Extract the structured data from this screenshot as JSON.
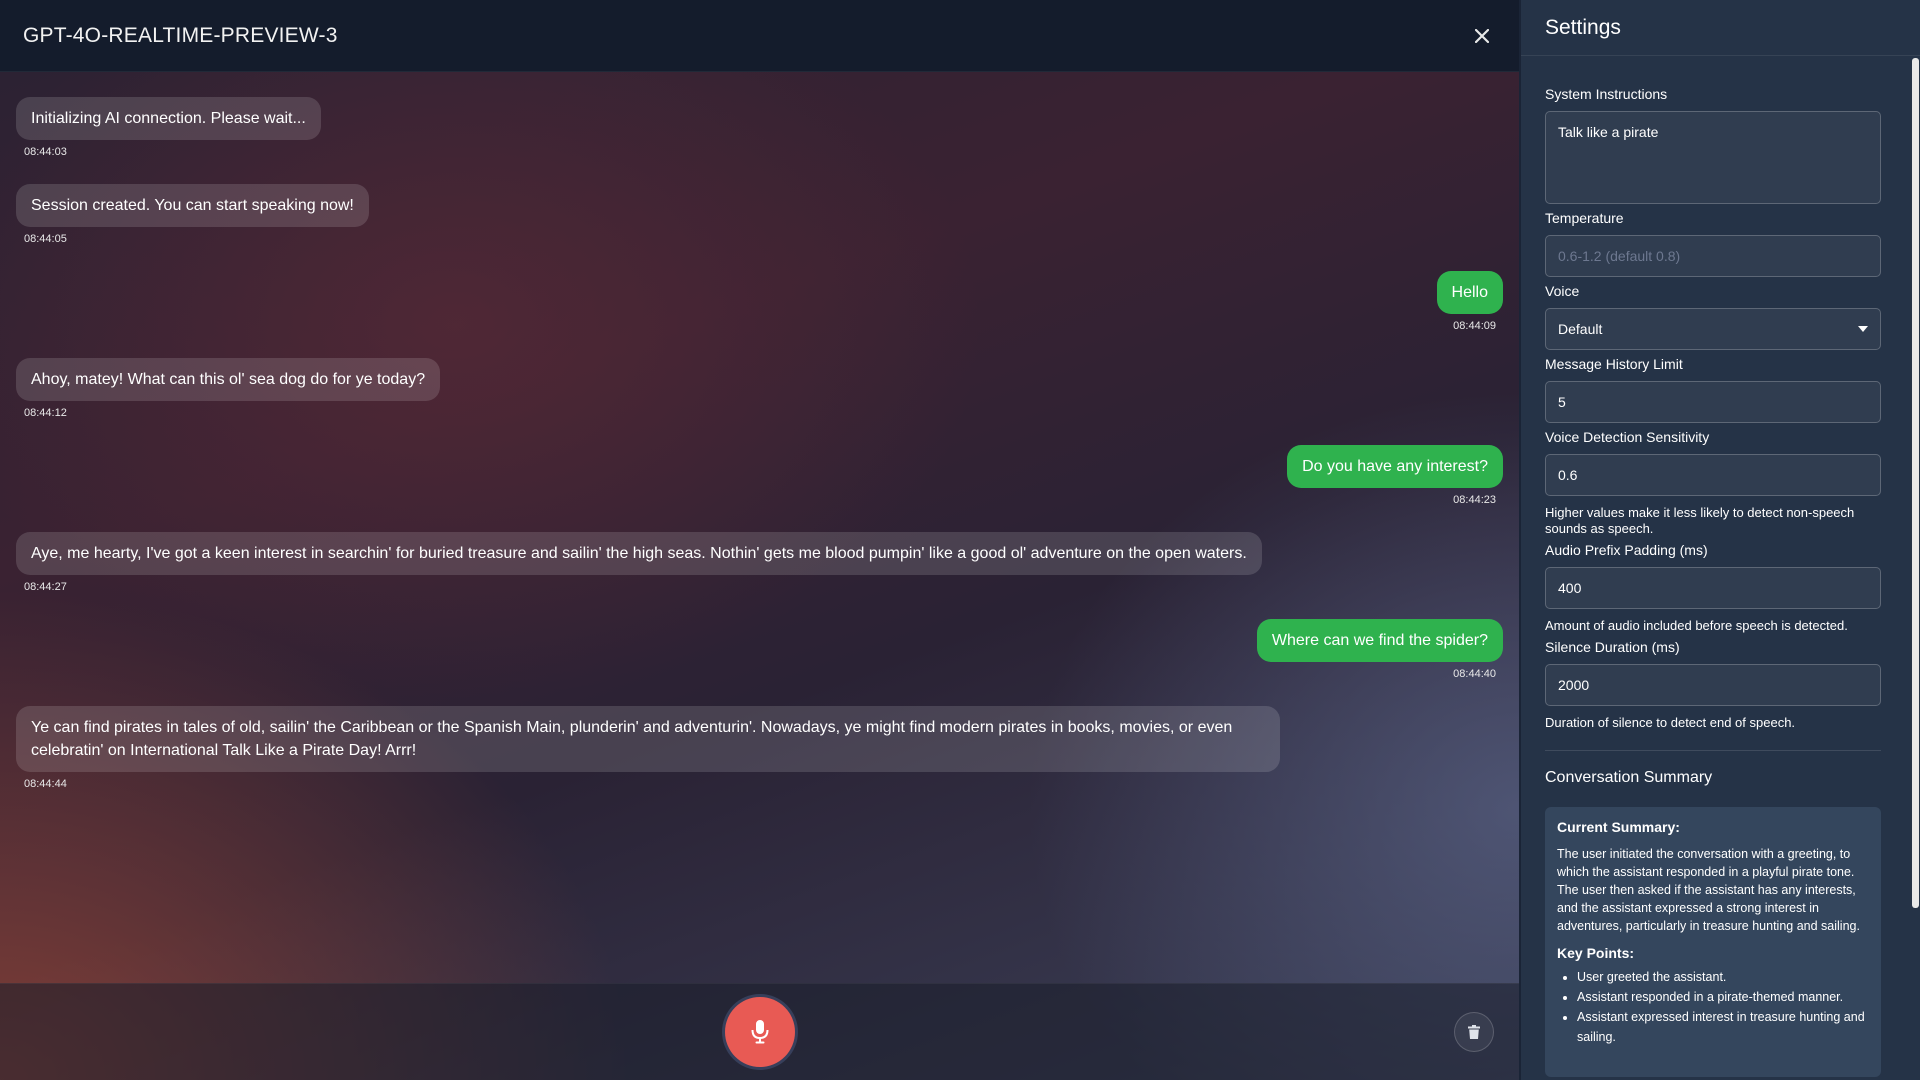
{
  "header": {
    "title": "GPT-4O-REALTIME-PREVIEW-3"
  },
  "messages": [
    {
      "role": "assistant",
      "text": "Initializing AI connection. Please wait...",
      "time": "08:44:03"
    },
    {
      "role": "assistant",
      "text": "Session created. You can start speaking now!",
      "time": "08:44:05"
    },
    {
      "role": "user",
      "text": "Hello",
      "time": "08:44:09"
    },
    {
      "role": "assistant",
      "text": "Ahoy, matey! What can this ol' sea dog do for ye today?",
      "time": "08:44:12"
    },
    {
      "role": "user",
      "text": "Do you have any interest?",
      "time": "08:44:23"
    },
    {
      "role": "assistant",
      "text": "Aye, me hearty, I've got a keen interest in searchin' for buried treasure and sailin' the high seas. Nothin' gets me blood pumpin' like a good ol' adventure on the open waters.",
      "time": "08:44:27"
    },
    {
      "role": "user",
      "text": "Where can we find the spider?",
      "time": "08:44:40"
    },
    {
      "role": "assistant",
      "text": "Ye can find pirates in tales of old, sailin' the Caribbean or the Spanish Main, plunderin' and adventurin'. Nowadays, ye might find modern pirates in books, movies, or even celebratin' on International Talk Like a Pirate Day! Arrr!",
      "time": "08:44:44"
    }
  ],
  "settings": {
    "title": "Settings",
    "system_instructions": {
      "label": "System Instructions",
      "value": "Talk like a pirate"
    },
    "temperature": {
      "label": "Temperature",
      "placeholder": "0.6-1.2 (default 0.8)"
    },
    "voice": {
      "label": "Voice",
      "value": "Default"
    },
    "history_limit": {
      "label": "Message History Limit",
      "value": "5"
    },
    "vad_sensitivity": {
      "label": "Voice Detection Sensitivity",
      "value": "0.6",
      "help": "Higher values make it less likely to detect non-speech sounds as speech."
    },
    "prefix_padding": {
      "label": "Audio Prefix Padding (ms)",
      "value": "400",
      "help": "Amount of audio included before speech is detected."
    },
    "silence_duration": {
      "label": "Silence Duration (ms)",
      "value": "2000",
      "help": "Duration of silence to detect end of speech."
    }
  },
  "summary": {
    "heading": "Conversation Summary",
    "current_label": "Current Summary:",
    "current_text": "The user initiated the conversation with a greeting, to which the assistant responded in a playful pirate tone. The user then asked if the assistant has any interests, and the assistant expressed a strong interest in adventures, particularly in treasure hunting and sailing.",
    "key_points_label": "Key Points:",
    "key_points": [
      "User greeted the assistant.",
      "Assistant responded in a pirate-themed manner.",
      "Assistant expressed interest in treasure hunting and sailing."
    ]
  },
  "icons": {
    "close": "close-icon",
    "mic": "microphone-icon",
    "trash": "trash-icon",
    "dropdown": "caret-down-icon"
  },
  "colors": {
    "user_bubble": "#2fb24e",
    "mic_button": "#e85a54",
    "header": "#141c2c",
    "settings_bg": "#253347"
  }
}
